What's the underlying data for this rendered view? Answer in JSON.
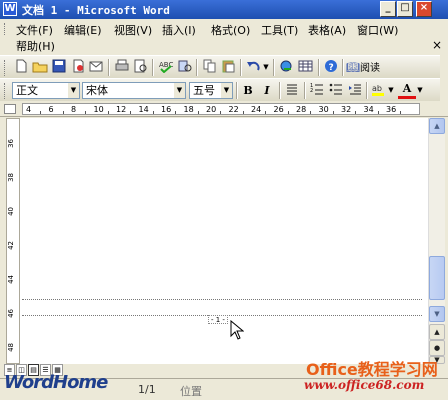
{
  "window": {
    "title": "文档 1 - Microsoft Word",
    "app_icon": "W"
  },
  "menu": {
    "items": [
      "文件(F)",
      "编辑(E)",
      "视图(V)",
      "插入(I)",
      "格式(O)",
      "工具(T)",
      "表格(A)",
      "窗口(W)"
    ],
    "help": "帮助(H)",
    "close_glyph": "×"
  },
  "toolbar": {
    "read_label": "阅读(R)"
  },
  "format_bar": {
    "style": "正文",
    "font": "宋体",
    "size": "五号",
    "bold": "B",
    "italic": "I",
    "font_color": "A"
  },
  "ruler": {
    "h_ticks": [
      "4",
      "6",
      "8",
      "10",
      "12",
      "14",
      "16",
      "18",
      "20",
      "22",
      "24",
      "26",
      "28",
      "30",
      "32",
      "34",
      "36"
    ],
    "v_ticks": [
      "36",
      "38",
      "40",
      "42",
      "44",
      "46",
      "48"
    ]
  },
  "document": {
    "page_number": "- 1 -"
  },
  "statusbar": {
    "page_count": "1/1",
    "position_label": "位置"
  },
  "watermark": {
    "left": "WordHome",
    "right_title": "Office教程学习网",
    "right_url": "www.office68.com"
  },
  "colors": {
    "title_bar": "#1e4fb0",
    "scroll_accent": "#b2c6ef",
    "watermark_orange": "#e8601a"
  }
}
